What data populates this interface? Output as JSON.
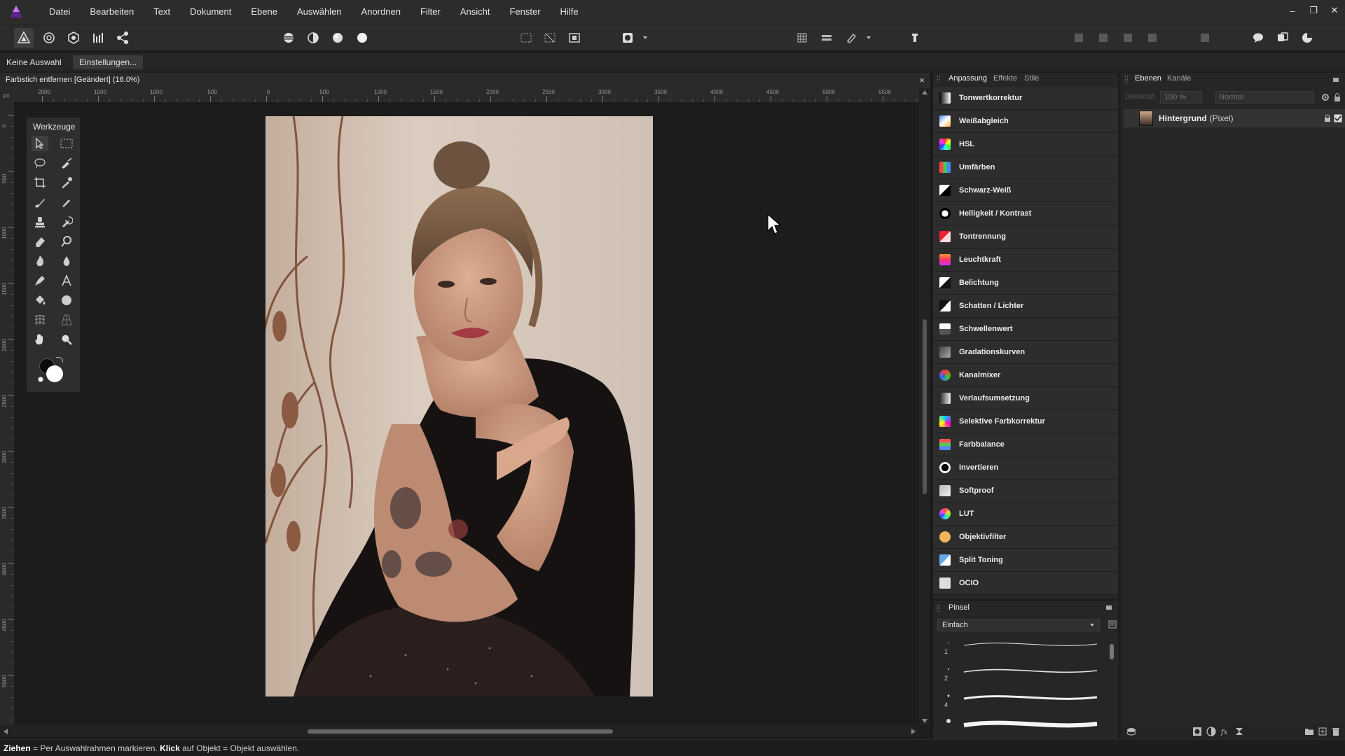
{
  "menu": {
    "items": [
      "Datei",
      "Bearbeiten",
      "Text",
      "Dokument",
      "Ebene",
      "Auswählen",
      "Anordnen",
      "Filter",
      "Ansicht",
      "Fenster",
      "Hilfe"
    ]
  },
  "window_controls": {
    "minimize": "–",
    "restore": "❐",
    "close": "✕"
  },
  "context": {
    "selection_label": "Keine Auswahl",
    "settings_button": "Einstellungen..."
  },
  "document": {
    "title": "Farbstich entfernen [Geändert] (16.0%)",
    "close": "×"
  },
  "rulers": {
    "unit": "px",
    "horizontal_labels": [
      "2000",
      "1500",
      "1000",
      "500",
      "0",
      "500",
      "1000",
      "1500",
      "2000",
      "2500",
      "3000",
      "3500",
      "4000",
      "4500",
      "5000",
      "5500"
    ],
    "vertical_labels": [
      "0",
      "500",
      "1000",
      "1500",
      "2000",
      "2500",
      "3000",
      "3500",
      "4000",
      "4500",
      "5000"
    ]
  },
  "tools": {
    "title": "Werkzeuge"
  },
  "adjustments": {
    "tabs": [
      "Anpassung",
      "Effekte",
      "Stile"
    ],
    "items": [
      {
        "label": "Tonwertkorrektur",
        "icon": "levels-icon"
      },
      {
        "label": "Weißabgleich",
        "icon": "white-balance-icon"
      },
      {
        "label": "HSL",
        "icon": "hsl-icon"
      },
      {
        "label": "Umfärben",
        "icon": "recolor-icon"
      },
      {
        "label": "Schwarz-Weiß",
        "icon": "black-white-icon"
      },
      {
        "label": "Helligkeit / Kontrast",
        "icon": "brightness-contrast-icon"
      },
      {
        "label": "Tontrennung",
        "icon": "posterize-icon"
      },
      {
        "label": "Leuchtkraft",
        "icon": "vibrance-icon"
      },
      {
        "label": "Belichtung",
        "icon": "exposure-icon"
      },
      {
        "label": "Schatten / Lichter",
        "icon": "shadows-highlights-icon"
      },
      {
        "label": "Schwellenwert",
        "icon": "threshold-icon"
      },
      {
        "label": "Gradationskurven",
        "icon": "curves-icon"
      },
      {
        "label": "Kanalmixer",
        "icon": "channel-mixer-icon"
      },
      {
        "label": "Verlaufsumsetzung",
        "icon": "gradient-map-icon"
      },
      {
        "label": "Selektive Farbkorrektur",
        "icon": "selective-color-icon"
      },
      {
        "label": "Farbbalance",
        "icon": "color-balance-icon"
      },
      {
        "label": "Invertieren",
        "icon": "invert-icon"
      },
      {
        "label": "Softproof",
        "icon": "soft-proof-icon"
      },
      {
        "label": "LUT",
        "icon": "lut-icon"
      },
      {
        "label": "Objektivfilter",
        "icon": "lens-filter-icon"
      },
      {
        "label": "Split Toning",
        "icon": "split-toning-icon"
      },
      {
        "label": "OCIO",
        "icon": "ocio-icon"
      }
    ]
  },
  "brushes": {
    "tab": "Pinsel",
    "category": "Einfach",
    "sizes": [
      "1",
      "2",
      "4"
    ]
  },
  "layers": {
    "tabs": [
      "Ebenen",
      "Kanäle"
    ],
    "opacity": "100 %",
    "blend_mode": "Normal",
    "opacity_label": "Deckkraft",
    "items": [
      {
        "name": "Hintergrund",
        "type": "(Pixel)"
      }
    ]
  },
  "status": {
    "drag_key": "Ziehen",
    "drag_text": " = Per Auswahlrahmen markieren. ",
    "click_key": "Klick",
    "click_text": " auf Objekt = Objekt auswählen."
  },
  "colors": {
    "accent": "#9b4dca",
    "panel_bg": "#262626",
    "canvas_bg": "#1c1c1c"
  }
}
